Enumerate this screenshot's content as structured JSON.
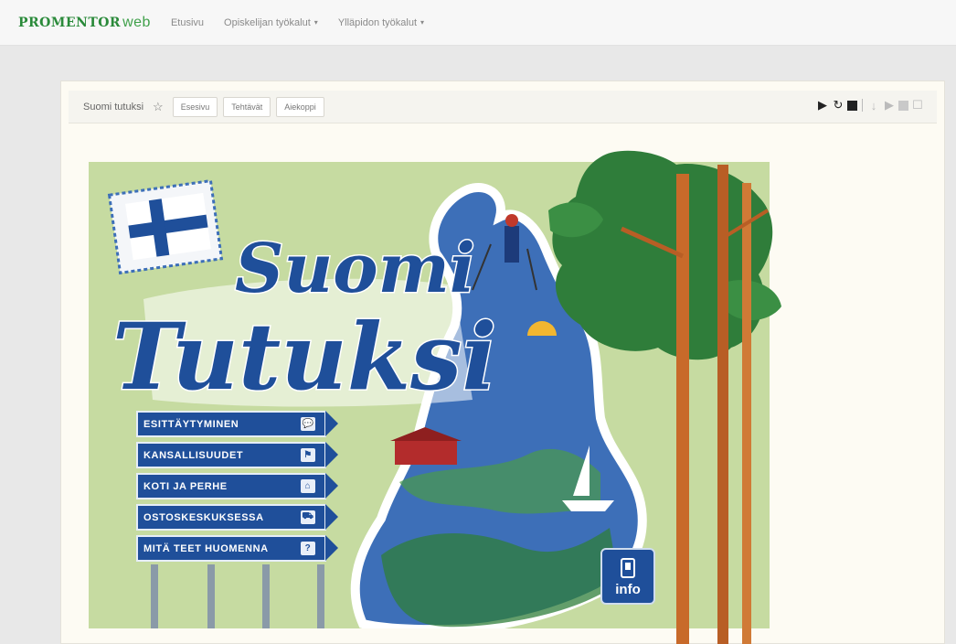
{
  "nav": {
    "brand_a": "PROMENTOR",
    "brand_b": "web",
    "items": [
      {
        "label": "Etusivu",
        "caret": ""
      },
      {
        "label": "Opiskelijan työkalut",
        "caret": "▾"
      },
      {
        "label": "Ylläpidon työkalut",
        "caret": "▾"
      }
    ]
  },
  "toolbar": {
    "title": "Suomi tutuksi",
    "star": "☆",
    "buttons": [
      "Esesivu",
      "Tehtävät",
      "Aiekoppi"
    ]
  },
  "stage": {
    "title_line1": "Suomi",
    "title_line2": "Tutuksi",
    "menu": [
      {
        "label": "ESITTÄYTYMINEN",
        "icon": "speech-bubbles-icon",
        "glyph": "💬"
      },
      {
        "label": "KANSALLISUUDET",
        "icon": "flag-icon",
        "glyph": "⚑"
      },
      {
        "label": "KOTI JA PERHE",
        "icon": "home-icon",
        "glyph": "⌂"
      },
      {
        "label": "OSTOSKESKUKSESSA",
        "icon": "cart-icon",
        "glyph": "⛟"
      },
      {
        "label": "MITÄ TEET HUOMENNA",
        "icon": "calendar-question-icon",
        "glyph": "?"
      }
    ],
    "info_label": "info"
  },
  "colors": {
    "sign_blue": "#1f4f9a",
    "lake_blue": "#3d6fb8",
    "meadow_green": "#c6dba1",
    "forest_green": "#2f7d3a",
    "trunk_orange": "#c86a2a"
  }
}
